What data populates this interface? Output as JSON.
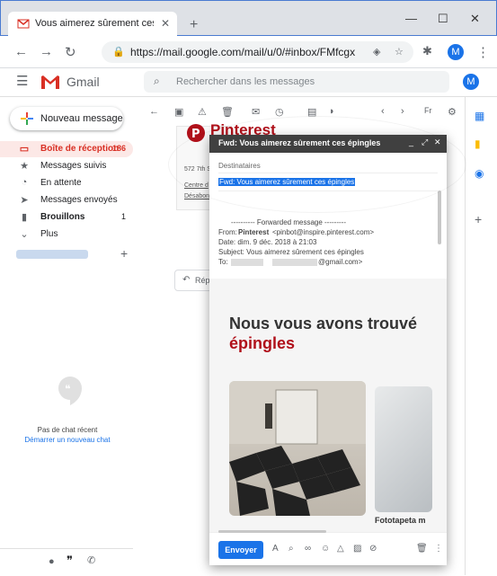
{
  "browser": {
    "tab_title": "Vous aimerez sûrement ces épingles",
    "url": "https://mail.google.com/mail/u/0/#inbox/FMfcgxvz...",
    "avatar_letter": "M"
  },
  "gmail": {
    "app_name": "Gmail",
    "search_placeholder": "Rechercher dans les messages",
    "avatar_letter": "M",
    "compose_label": "Nouveau message",
    "nav": [
      {
        "label": "Boîte de réception",
        "count": "186"
      },
      {
        "label": "Messages suivis",
        "count": ""
      },
      {
        "label": "En attente",
        "count": ""
      },
      {
        "label": "Messages envoyés",
        "count": ""
      },
      {
        "label": "Brouillons",
        "count": "1"
      },
      {
        "label": "Plus",
        "count": ""
      }
    ],
    "chat": {
      "empty_text": "Pas de chat récent",
      "start_link": "Démarrer un nouveau chat"
    },
    "toolbar_lang": "Fr",
    "reply_partial": "Rép"
  },
  "email_card": {
    "brand": "Pinterest",
    "address": "572 7th S",
    "link1": "Centre d",
    "link2": "Désabon"
  },
  "compose": {
    "title": "Fwd: Vous aimerez sûrement ces épingles",
    "to_label": "Destinataires",
    "subject": "Fwd: Vous aimerez sûrement ces épingles",
    "fwd_header": "---------- Forwarded message ---------",
    "from_label": "From:",
    "from_name": "Pinterest",
    "from_email": "<pinbot@inspire.pinterest.com>",
    "date_line": "Date: dim. 9 déc. 2018 à 21:03",
    "subject_line": "Subject: Vous aimerez sûrement ces épingles",
    "to_line_label": "To:",
    "to_line_email": "@gmail.com>",
    "body_title_1": "Nous vous avons trouvé",
    "body_title_2": "épingles",
    "caption_2": "Fototapeta m",
    "send_label": "Envoyer"
  },
  "colors": {
    "gmail_red": "#d93025",
    "accent_blue": "#1a73e8",
    "pinterest_red": "#b0101a"
  }
}
